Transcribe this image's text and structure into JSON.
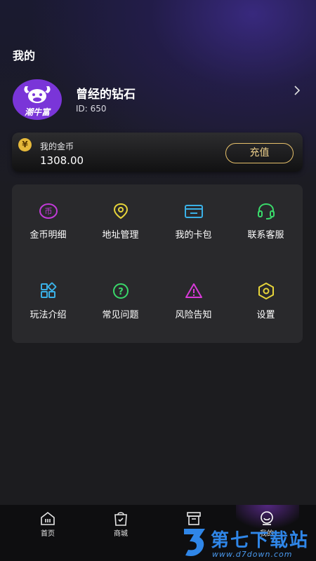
{
  "header": {
    "title": "我的"
  },
  "profile": {
    "avatar_text": "潮牛富",
    "username": "曾经的钻石",
    "id_label": "ID: 650"
  },
  "wallet": {
    "coin_symbol": "¥",
    "label": "我的金币",
    "amount": "1308.00",
    "recharge_label": "充值"
  },
  "menu": {
    "items": [
      {
        "label": "金币明细",
        "icon": "coin-icon",
        "color": "#c23ad8"
      },
      {
        "label": "地址管理",
        "icon": "location-pin-icon",
        "color": "#e6d43a"
      },
      {
        "label": "我的卡包",
        "icon": "card-wallet-icon",
        "color": "#3ab0e6"
      },
      {
        "label": "联系客服",
        "icon": "headset-icon",
        "color": "#3ad86a"
      },
      {
        "label": "玩法介绍",
        "icon": "grid-shapes-icon",
        "color": "#3ab0e6"
      },
      {
        "label": "常见问题",
        "icon": "question-circle-icon",
        "color": "#3ad86a"
      },
      {
        "label": "风险告知",
        "icon": "warning-triangle-icon",
        "color": "#d83ad8"
      },
      {
        "label": "设置",
        "icon": "settings-hexagon-icon",
        "color": "#e6d43a"
      }
    ]
  },
  "nav": {
    "items": [
      {
        "label": "首页",
        "icon": "home-icon"
      },
      {
        "label": "商城",
        "icon": "shopping-bag-icon"
      },
      {
        "label": "",
        "icon": "box-icon"
      },
      {
        "label": "我的",
        "icon": "profile-icon"
      }
    ]
  },
  "watermark": {
    "text": "第七下载站",
    "url": "www.d7down.com"
  }
}
